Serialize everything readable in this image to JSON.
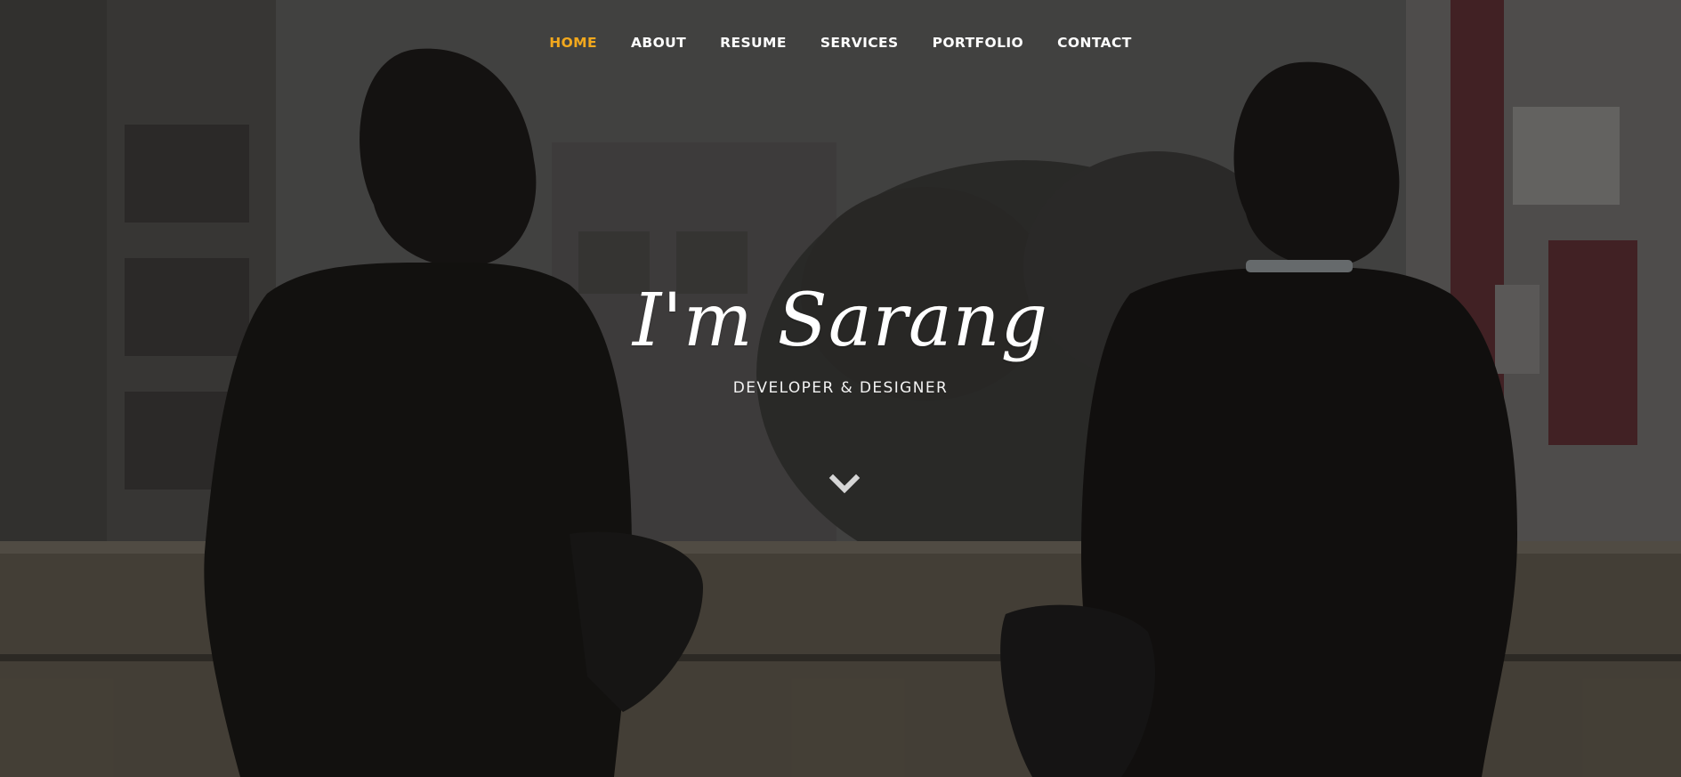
{
  "nav": {
    "items": [
      {
        "label": "HOME",
        "active": true
      },
      {
        "label": "ABOUT",
        "active": false
      },
      {
        "label": "RESUME",
        "active": false
      },
      {
        "label": "SERVICES",
        "active": false
      },
      {
        "label": "PORTFOLIO",
        "active": false
      },
      {
        "label": "CONTACT",
        "active": false
      }
    ]
  },
  "hero": {
    "headline": "I'm Sarang",
    "subtitle": "DEVELOPER & DESIGNER",
    "scroll_icon": "chevron-down-icon"
  },
  "colors": {
    "accent": "#f2a81d",
    "text": "#ffffff"
  }
}
